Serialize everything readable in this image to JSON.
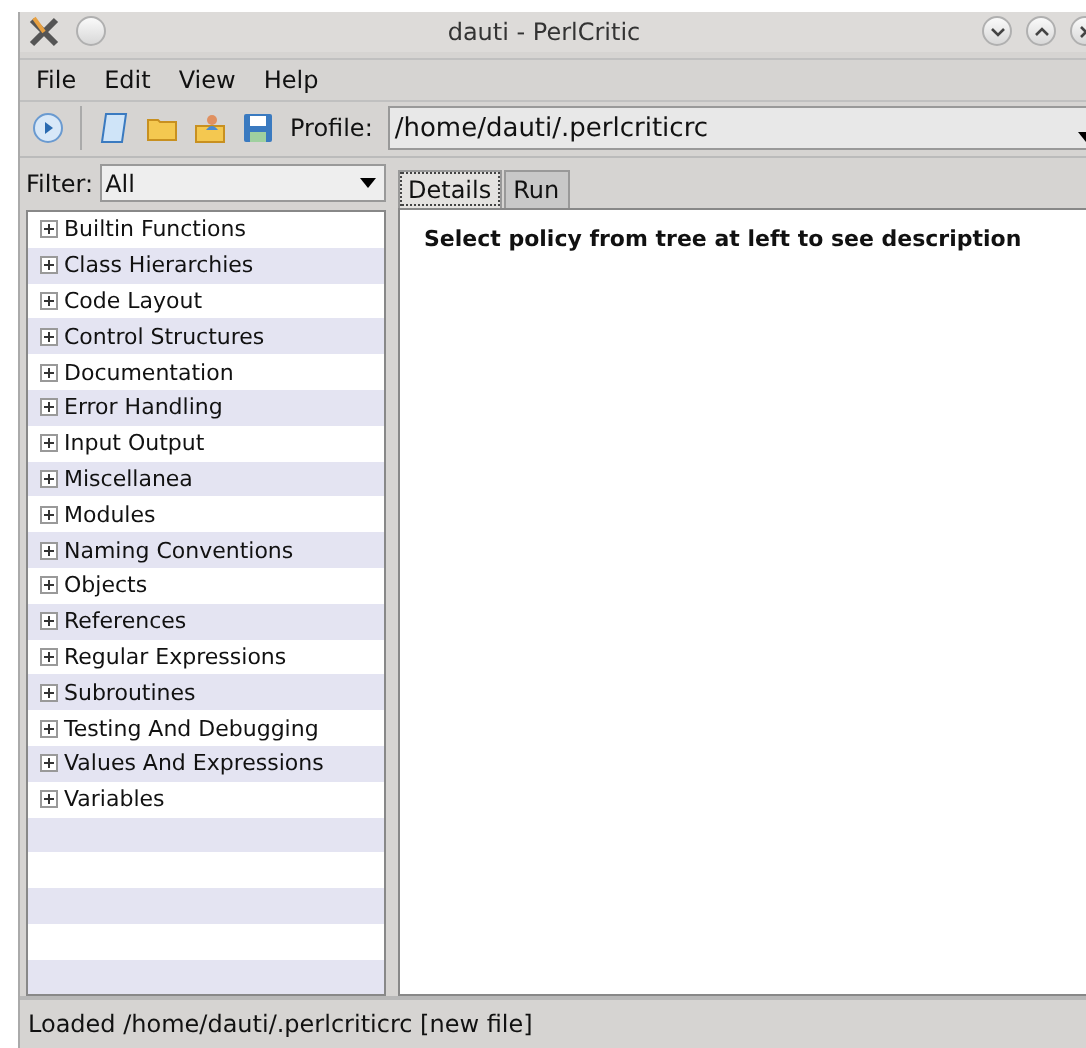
{
  "window": {
    "title": "dauti - PerlCritic"
  },
  "menu": [
    "File",
    "Edit",
    "View",
    "Help"
  ],
  "toolbar": {
    "profile_label": "Profile:",
    "profile_value": "/home/dauti/.perlcriticrc"
  },
  "filter": {
    "label": "Filter:",
    "value": "All"
  },
  "tree": [
    {
      "label": "Builtin Functions",
      "expanded": false
    },
    {
      "label": "Class Hierarchies",
      "expanded": false
    },
    {
      "label": "Code Layout",
      "expanded": false
    },
    {
      "label": "Control Structures",
      "expanded": false
    },
    {
      "label": "Documentation",
      "expanded": false
    },
    {
      "label": "Error Handling",
      "expanded": false
    },
    {
      "label": "Input Output",
      "expanded": false
    },
    {
      "label": "Miscellanea",
      "expanded": false
    },
    {
      "label": "Modules",
      "expanded": false
    },
    {
      "label": "Naming Conventions",
      "expanded": false
    },
    {
      "label": "Objects",
      "expanded": false
    },
    {
      "label": "References",
      "expanded": false
    },
    {
      "label": "Regular Expressions",
      "expanded": false
    },
    {
      "label": "Subroutines",
      "expanded": false
    },
    {
      "label": "Testing And Debugging",
      "expanded": false
    },
    {
      "label": "Values And Expressions",
      "expanded": false
    },
    {
      "label": "Variables",
      "expanded": false
    }
  ],
  "tabs": [
    {
      "label": "Details",
      "selected": true
    },
    {
      "label": "Run",
      "selected": false
    }
  ],
  "details": {
    "message": "Select policy from tree at left to see description"
  },
  "status_bar": "Loaded /home/dauti/.perlcriticrc [new file]"
}
